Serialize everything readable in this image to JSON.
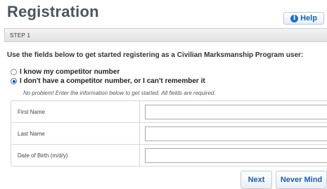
{
  "page": {
    "title": "Registration",
    "help_label": "Help",
    "help_icon": "info-icon"
  },
  "step": {
    "label": "STEP 1"
  },
  "intro_text": "Use the fields below to get started registering as a Civilian Marksmanship Program user:",
  "options": [
    {
      "label": "I know my competitor number",
      "selected": false
    },
    {
      "label": "I don't have a competitor number, or I can't remember it",
      "selected": true
    }
  ],
  "note": "No problem! Enter the information below to get started. All fields are required.",
  "fields": [
    {
      "label": "First Name",
      "value": ""
    },
    {
      "label": "Last Name",
      "value": ""
    },
    {
      "label": "Date of Birth (m/d/y)",
      "value": ""
    }
  ],
  "buttons": {
    "next": "Next",
    "never_mind": "Never Mind"
  },
  "colors": {
    "title": "#4a5560",
    "button_text": "#1f5fa6",
    "selected_radio": "#1a4fa0"
  }
}
